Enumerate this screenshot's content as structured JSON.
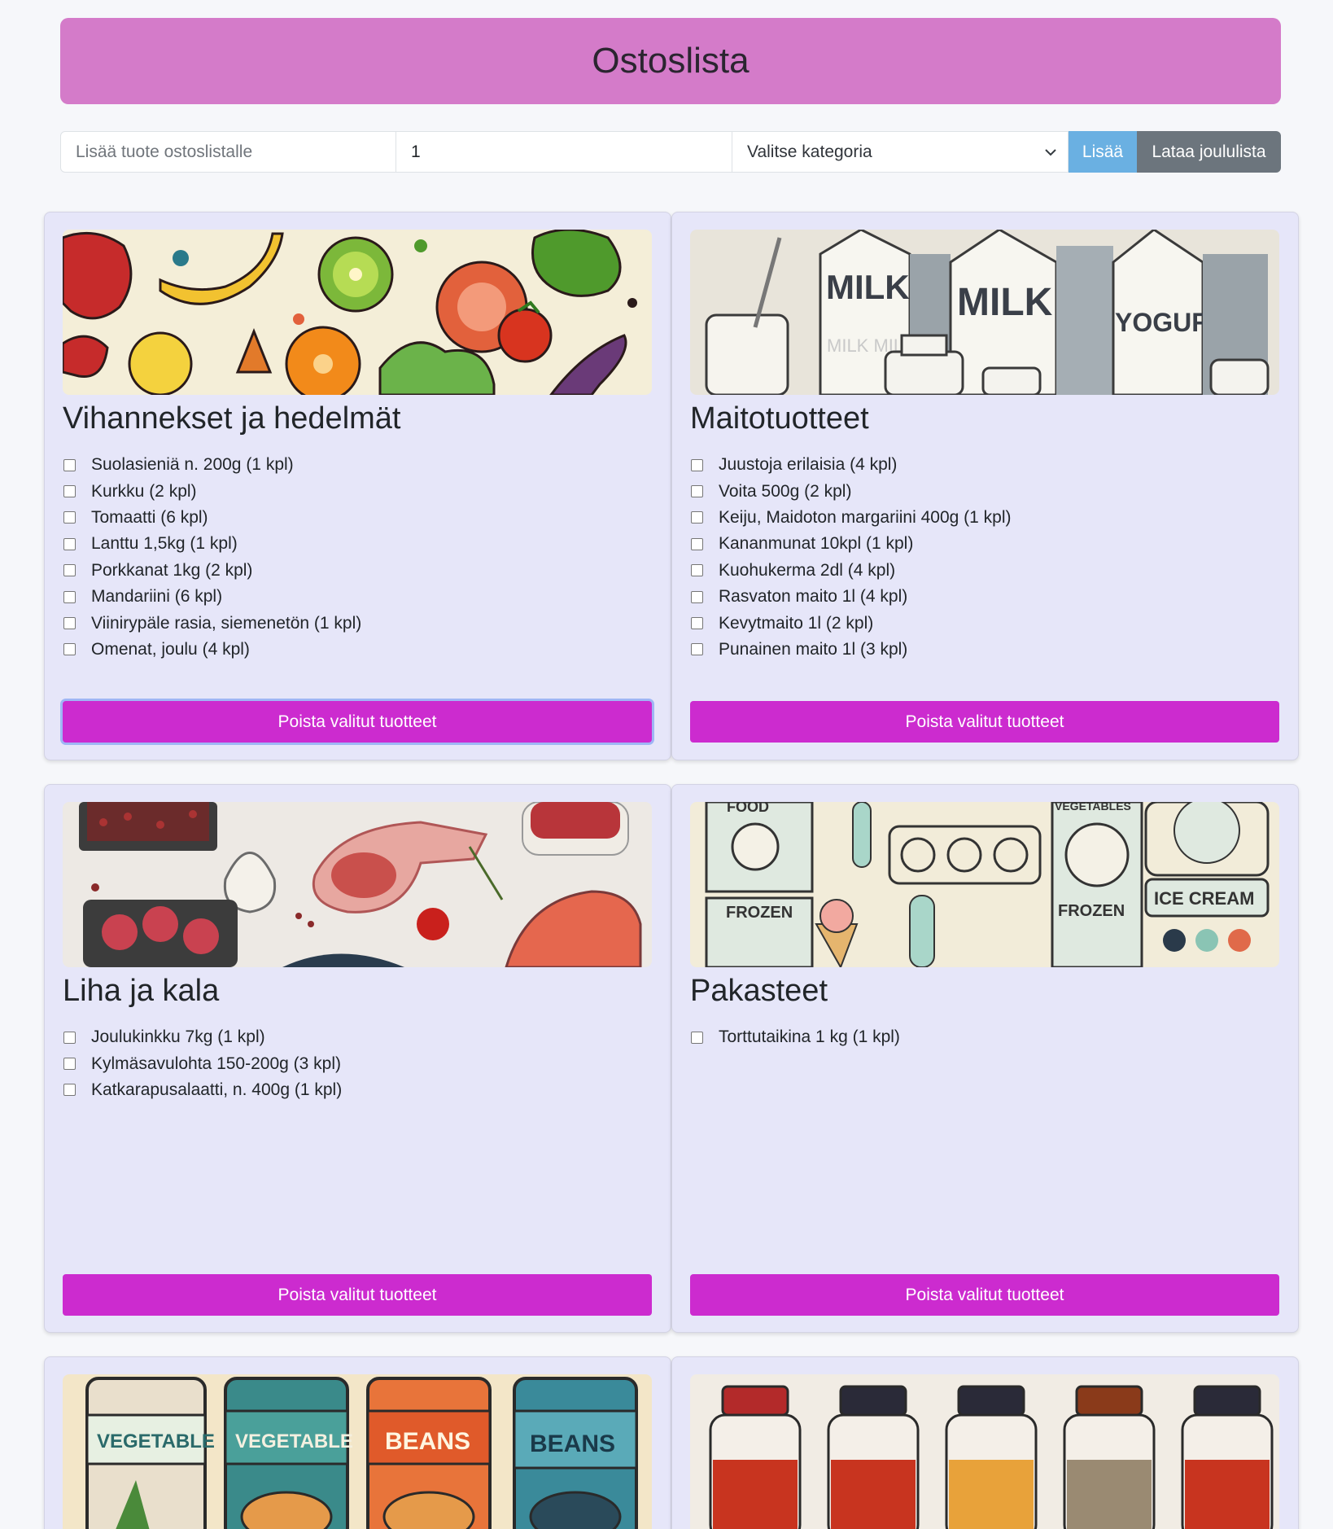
{
  "header": {
    "title": "Ostoslista"
  },
  "form": {
    "product_placeholder": "Lisää tuote ostoslistalle",
    "quantity_value": "1",
    "category_selected": "Valitse kategoria",
    "add_label": "Lisää",
    "load_label": "Lataa joululista"
  },
  "colors": {
    "header": "#d47bc9",
    "card": "#e6e6f9",
    "delete_button": "#cc2bcf",
    "add_button": "#6ab0e2",
    "load_button": "#6c757d"
  },
  "delete_label": "Poista valitut tuotteet",
  "categories": [
    {
      "title": "Vihannekset ja hedelmät",
      "image": "fruit-vegetable-illustration",
      "items": [
        "Suolasieniä n. 200g (1 kpl)",
        "Kurkku (2 kpl)",
        "Tomaatti (6 kpl)",
        "Lanttu 1,5kg (1 kpl)",
        "Porkkanat 1kg (2 kpl)",
        "Mandariini (6 kpl)",
        "Viinirypäle rasia, siemenetön (1 kpl)",
        "Omenat, joulu (4 kpl)"
      ]
    },
    {
      "title": "Maitotuotteet",
      "image": "dairy-illustration",
      "image_text": [
        "MILK",
        "MILK",
        "YOGURT",
        "MILK MILK"
      ],
      "items": [
        "Juustoja erilaisia (4 kpl)",
        "Voita 500g (2 kpl)",
        "Keiju, Maidoton margariini 400g (1 kpl)",
        "Kananmunat 10kpl (1 kpl)",
        "Kuohukerma 2dl (4 kpl)",
        "Rasvaton maito 1l (4 kpl)",
        "Kevytmaito 1l (2 kpl)",
        "Punainen maito 1l (3 kpl)"
      ]
    },
    {
      "title": "Liha ja kala",
      "image": "meat-fish-illustration",
      "items": [
        "Joulukinkku 7kg (1 kpl)",
        "Kylmäsavulohta 150-200g (3 kpl)",
        "Katkarapusalaatti, n. 400g (1 kpl)"
      ]
    },
    {
      "title": "Pakasteet",
      "image": "frozen-food-illustration",
      "image_text": [
        "FOOD",
        "FROZEN",
        "VEGETABLES",
        "FROZEN",
        "ICE CREAM"
      ],
      "items": [
        "Torttutaikina 1 kg (1 kpl)"
      ]
    },
    {
      "image": "canned-goods-illustration",
      "image_text": [
        "VEGETABLE",
        "VEGETABLE",
        "BEANS",
        "BEANS"
      ]
    },
    {
      "image": "spice-jars-illustration"
    }
  ]
}
